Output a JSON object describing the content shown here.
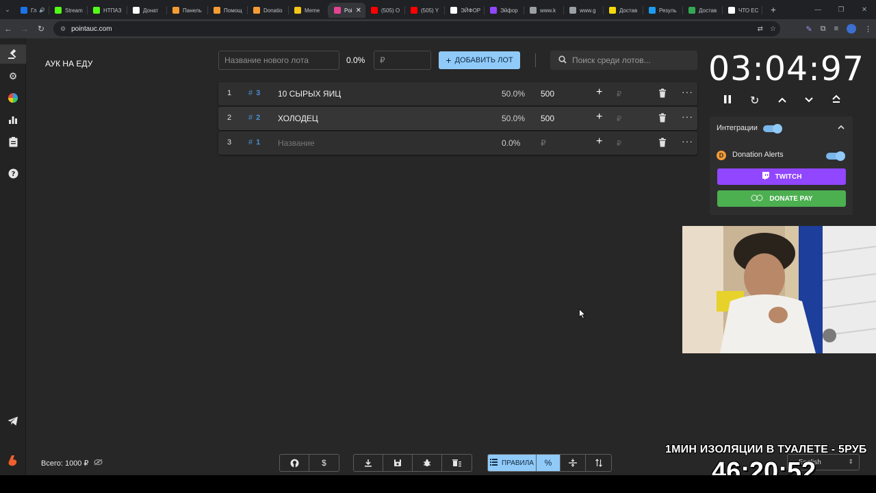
{
  "browser": {
    "tabs": [
      {
        "title": "Глав",
        "color": "#1a73e8",
        "icon": "play-icon",
        "audio": true
      },
      {
        "title": "Stream",
        "color": "#53fc18",
        "icon": "kick-icon"
      },
      {
        "title": "НТПАЗ",
        "color": "#53fc18",
        "icon": "kick-icon"
      },
      {
        "title": "Донат",
        "color": "#ffffff",
        "icon": "s-icon"
      },
      {
        "title": "Панель",
        "color": "#f59c34",
        "icon": "donationalerts-icon"
      },
      {
        "title": "Помощ",
        "color": "#f59c34",
        "icon": "donationalerts-icon"
      },
      {
        "title": "Donatio",
        "color": "#f59c34",
        "icon": "donationalerts-icon"
      },
      {
        "title": "Meme",
        "color": "#f5c518",
        "icon": "m-icon"
      },
      {
        "title": "Poi",
        "color": "#e84393",
        "icon": "pointauc-icon",
        "active": true
      },
      {
        "title": "(505) O",
        "color": "#ff0000",
        "icon": "youtube-icon"
      },
      {
        "title": "(505) Y",
        "color": "#ff0000",
        "icon": "youtube-icon"
      },
      {
        "title": "ЭЙФОР",
        "color": "#ffffff",
        "icon": "chrome-icon"
      },
      {
        "title": "Эйфор",
        "color": "#9146ff",
        "icon": "e-icon"
      },
      {
        "title": "www.k",
        "color": "#9aa0a6",
        "icon": "globe-icon"
      },
      {
        "title": "www.g",
        "color": "#9aa0a6",
        "icon": "globe-icon"
      },
      {
        "title": "Достав",
        "color": "#f5d90a",
        "icon": "delivery-icon"
      },
      {
        "title": "Резуль",
        "color": "#1d9bf0",
        "icon": "bird-icon"
      },
      {
        "title": "Достав",
        "color": "#34a853",
        "icon": "delivery-icon"
      },
      {
        "title": "ЧТО ЕС",
        "color": "#ffffff",
        "icon": "chrome-icon"
      }
    ],
    "url": "pointauc.com"
  },
  "app": {
    "title": "АУК НА ЕДУ",
    "new_lot": {
      "name_placeholder": "Название нового лота",
      "percent": "0.0%",
      "amount_placeholder": "₽",
      "add_label": "ДОБАВИТЬ ЛОТ",
      "add_icon": "+"
    },
    "search": {
      "placeholder": "Поиск среди лотов..."
    },
    "lots": [
      {
        "index": "1",
        "hash": "#",
        "fast_id": "3",
        "name": "10 СЫРЫХ ЯИЦ",
        "percent": "50.0%",
        "amount": "500",
        "plus": "+",
        "currency": "₽",
        "more": "···"
      },
      {
        "index": "2",
        "hash": "#",
        "fast_id": "2",
        "name": "ХОЛОДЕЦ",
        "percent": "50.0%",
        "amount": "500",
        "plus": "+",
        "currency": "₽",
        "more": "···"
      },
      {
        "index": "3",
        "hash": "#",
        "fast_id": "1",
        "name": "Название",
        "percent": "0.0%",
        "amount": "₽",
        "plus": "+",
        "currency": "₽",
        "more": "···"
      }
    ],
    "timer": {
      "value": "03:04:97"
    },
    "integrations": {
      "label": "Интеграции",
      "enabled": true,
      "donation_alerts": "Donation Alerts",
      "twitch": "TWITCH",
      "donate_pay": "DONATE PAY"
    },
    "total": "Всего: 1000 ₽",
    "toolbar": {
      "rules": "ПРАВИЛА",
      "percent": "%"
    }
  },
  "overlay": {
    "title": "1МИН ИЗОЛЯЦИИ В ТУАЛЕТЕ - 5РУБ",
    "language": "English",
    "clock": "46:20:52"
  },
  "colors": {
    "accent": "#90caf9",
    "twitch": "#9146ff",
    "donate_pay": "#4caf50",
    "fast_id": "#4a90d9",
    "background": "#272727"
  }
}
